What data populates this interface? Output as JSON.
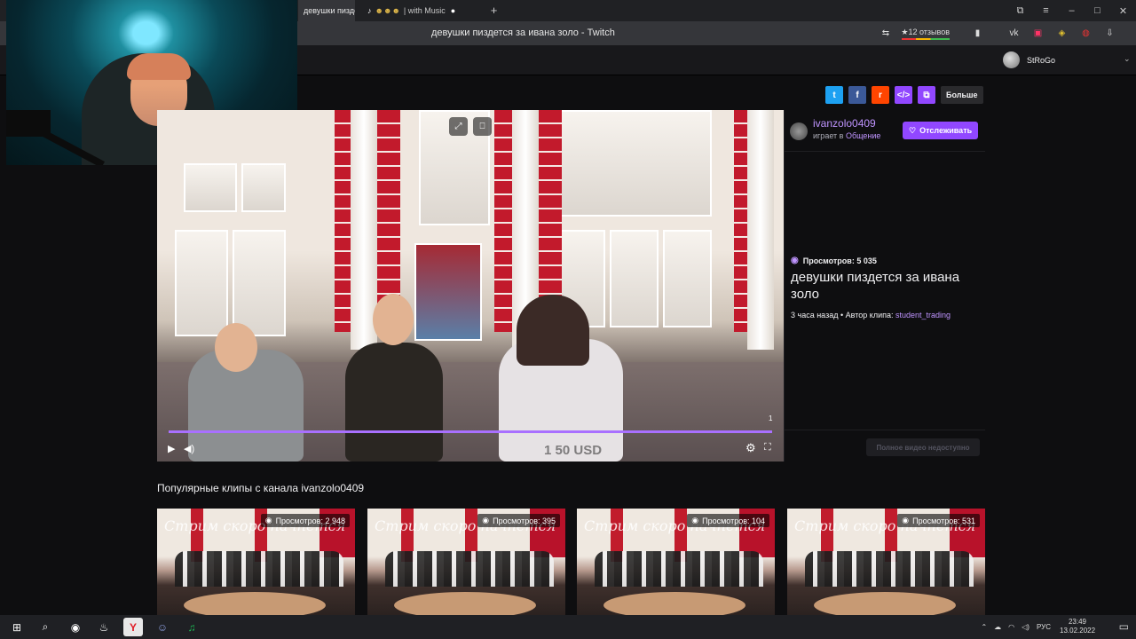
{
  "browser": {
    "tabs": [
      {
        "label": "девушки пиздется за и",
        "active": true
      },
      {
        "label": "| with Music",
        "active": false
      }
    ],
    "tab_close": "×",
    "tab_dot": "●",
    "new_tab": "+",
    "page_title": "девушки пиздется за ивана золо - Twitch",
    "reviews": "12 отзывов",
    "window_controls": [
      "⧉",
      "≡",
      "–",
      "□",
      "✕"
    ]
  },
  "nav": {
    "username": "StRoGo",
    "chevron": "⌄"
  },
  "share": {
    "buttons": [
      {
        "icon": "twitter-icon",
        "glyph": "t",
        "color": "#1da1f2"
      },
      {
        "icon": "facebook-icon",
        "glyph": "f",
        "color": "#3b5998"
      },
      {
        "icon": "reddit-icon",
        "glyph": "r",
        "color": "#ff4500"
      },
      {
        "icon": "embed-icon",
        "glyph": "</>",
        "color": "#9147ff"
      },
      {
        "icon": "copy-icon",
        "glyph": "⧉",
        "color": "#9147ff"
      }
    ],
    "more_label": "Больше"
  },
  "player": {
    "progress": 1.0,
    "time_label": "1",
    "watermark": "1 50 USD",
    "play_glyph": "▶",
    "volume_glyph": "◀)",
    "settings_glyph": "⚙",
    "fullscreen_glyph": "⛶",
    "top_controls": [
      "⤢",
      "⎕"
    ]
  },
  "channel": {
    "name": "ivanzolo0409",
    "playing_prefix": "играет в",
    "category": "Общение",
    "follow_label": "Отслеживать",
    "follow_glyph": "♡"
  },
  "clip": {
    "views_label": "Просмотров: 5 035",
    "eye_glyph": "◉",
    "title": "девушки пиздется за ивана золо",
    "time_ago": "3 часа назад",
    "separator": "•",
    "author_prefix": "Автор клипа:",
    "author": "student_trading",
    "full_video_label": "Полное видео недоступно"
  },
  "popular": {
    "title": "Популярные клипы с канала ivanzolo0409",
    "clips": [
      {
        "caption": "Стрим скоро начнется",
        "views": "Просмотров: 2 948"
      },
      {
        "caption": "Стрим скоро начнется",
        "views": "Просмотров: 395"
      },
      {
        "caption": "Стрим скоро начнется",
        "views": "Просмотров: 104"
      },
      {
        "caption": "Стрим скоро начнется",
        "views": "Просмотров: 531"
      }
    ]
  },
  "taskbar": {
    "icons": [
      {
        "name": "windows-start-icon",
        "glyph": "⊞"
      },
      {
        "name": "search-icon",
        "glyph": "⌕"
      },
      {
        "name": "obs-icon",
        "glyph": "◉"
      },
      {
        "name": "steam-icon",
        "glyph": "♨"
      },
      {
        "name": "yandex-browser-icon",
        "glyph": "Y"
      },
      {
        "name": "discord-icon",
        "glyph": "☺"
      },
      {
        "name": "spotify-icon",
        "glyph": "♫"
      }
    ],
    "lang": "РУС",
    "time": "23:49",
    "date": "13.02.2022"
  },
  "colors": {
    "twitch_purple": "#9147ff",
    "link_purple": "#bf94ff",
    "background": "#0e0e10"
  }
}
